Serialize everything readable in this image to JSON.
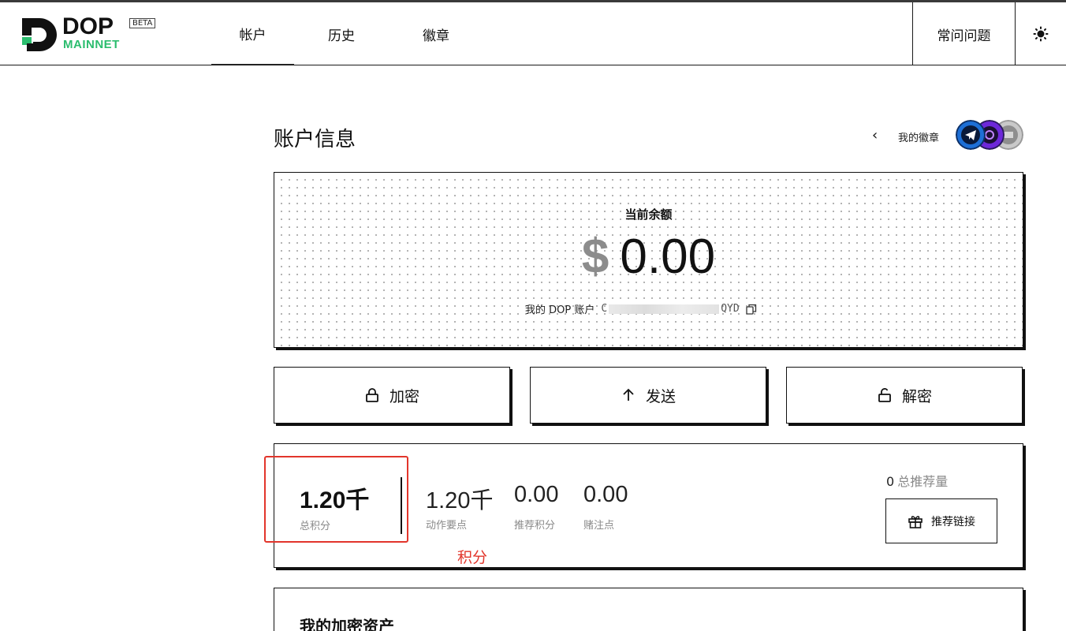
{
  "app": {
    "logo_text": "DOP",
    "network": "MAINNET",
    "beta_tag": "BETA",
    "brand_green": "#2bbd6e"
  },
  "nav": {
    "tabs": [
      {
        "label": "帐户",
        "active": true
      },
      {
        "label": "历史",
        "active": false
      },
      {
        "label": "徽章",
        "active": false
      }
    ],
    "faq_label": "常问问题",
    "theme_icon": "sun-icon"
  },
  "main": {
    "title": "账户信息",
    "badges_label": "我的徽章",
    "balance": {
      "label": "当前余额",
      "currency": "$",
      "amount": "0.00",
      "account_label": "我的 DOP 账户",
      "account_prefix": "C",
      "account_suffix": "QYD"
    },
    "actions": [
      {
        "label": "加密",
        "icon": "lock-icon"
      },
      {
        "label": "发送",
        "icon": "arrow-up-icon"
      },
      {
        "label": "解密",
        "icon": "unlock-icon"
      }
    ],
    "points": {
      "total_value": "1.20千",
      "total_label": "总积分",
      "items": [
        {
          "value": "1.20千",
          "label": "动作要点"
        },
        {
          "value": "0.00",
          "label": "推荐积分"
        },
        {
          "value": "0.00",
          "label": "赌注点"
        }
      ],
      "referral_count": "0",
      "referral_count_label": "总推荐量",
      "referral_button": "推荐链接"
    },
    "annotation": "积分",
    "assets_title": "我的加密资产"
  }
}
